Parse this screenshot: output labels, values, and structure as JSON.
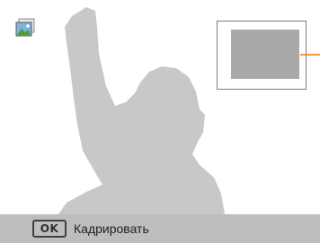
{
  "screen": {
    "preview_icon": "landscape-photo-icon"
  },
  "crop": {
    "frame_icon": "crop-area-frame"
  },
  "bottom_bar": {
    "ok_key_label": "OK",
    "action_label": "Кадрировать"
  },
  "colors": {
    "silhouette": "#c8c8c8",
    "bar": "#bdbdbd",
    "crop_fill": "#a9a9a9",
    "pointer": "#e79a4a"
  }
}
